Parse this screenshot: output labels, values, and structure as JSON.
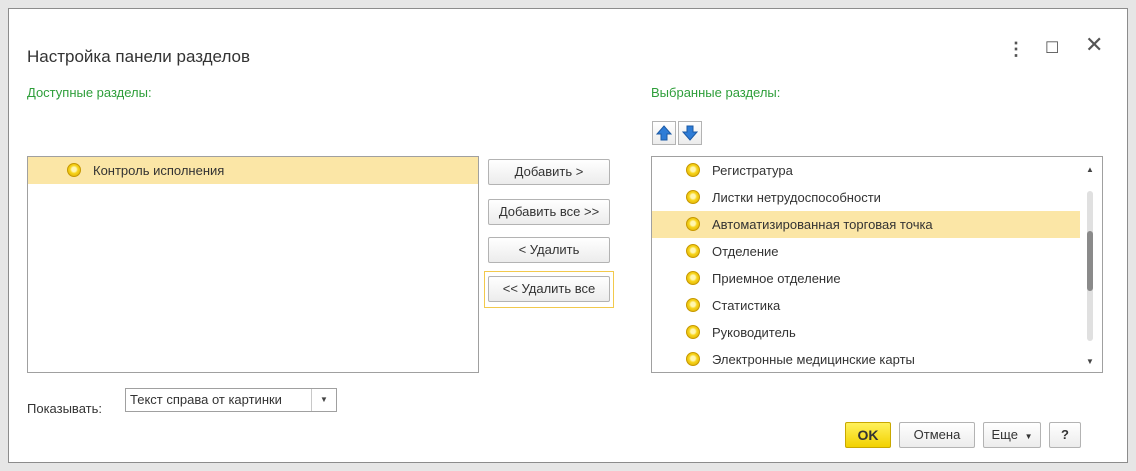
{
  "dialog": {
    "title": "Настройка панели разделов",
    "controls": {
      "more": "⋮",
      "maximize": "☐",
      "close": "✕"
    }
  },
  "available": {
    "label": "Доступные разделы:",
    "items": [
      {
        "label": "Контроль исполнения",
        "selected": true
      }
    ]
  },
  "selected": {
    "label": "Выбранные разделы:",
    "items": [
      {
        "label": "Регистратура",
        "selected": false
      },
      {
        "label": "Листки нетрудоспособности",
        "selected": false
      },
      {
        "label": "Автоматизированная торговая точка",
        "selected": true
      },
      {
        "label": "Отделение",
        "selected": false
      },
      {
        "label": "Приемное отделение",
        "selected": false
      },
      {
        "label": "Статистика",
        "selected": false
      },
      {
        "label": "Руководитель",
        "selected": false
      },
      {
        "label": "Электронные медицинские карты",
        "selected": false
      }
    ],
    "move_up_icon": "arrow-up-icon",
    "move_down_icon": "arrow-down-icon"
  },
  "actions": {
    "add": "Добавить >",
    "add_all": "Добавить все >>",
    "remove": "< Удалить",
    "remove_all": "<< Удалить все"
  },
  "show": {
    "label": "Показывать:",
    "value": "Текст справа от картинки"
  },
  "footer": {
    "ok": "OK",
    "cancel": "Отмена",
    "more": "Еще",
    "help": "?"
  },
  "colors": {
    "accent_green": "#2e9e3a",
    "selection": "#fbe6a6",
    "ok_yellow": "#f2d100",
    "arrow_blue": "#2e7cd6"
  }
}
